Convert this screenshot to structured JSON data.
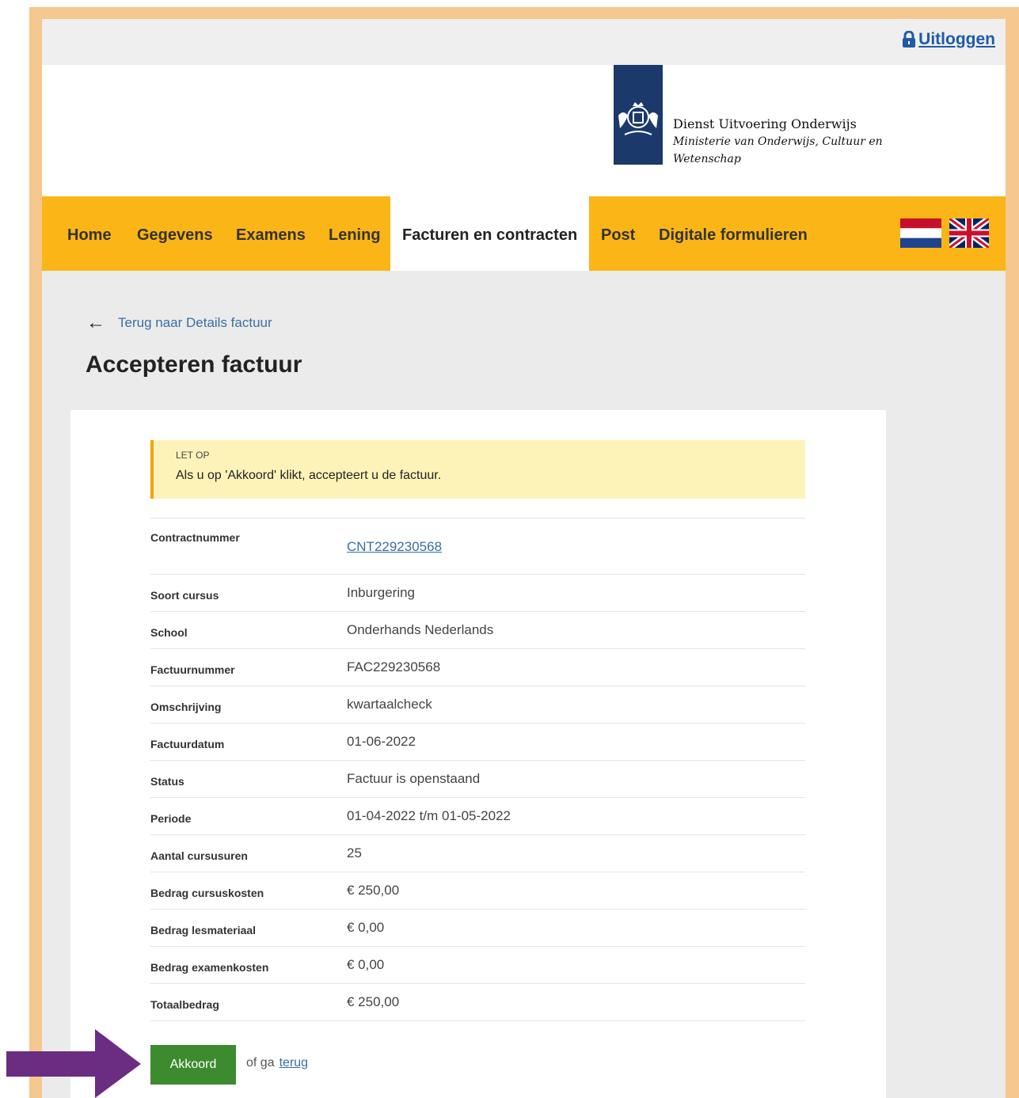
{
  "topbar": {
    "logout_label": "Uitloggen"
  },
  "header": {
    "org_name": "Dienst Uitvoering Onderwijs",
    "ministry_line1": "Ministerie van Onderwijs, Cultuur en",
    "ministry_line2": "Wetenschap"
  },
  "nav": {
    "items": [
      {
        "label": "Home"
      },
      {
        "label": "Gegevens"
      },
      {
        "label": "Examens"
      },
      {
        "label": "Lening"
      },
      {
        "label": "Facturen en contracten"
      },
      {
        "label": "Post"
      },
      {
        "label": "Digitale formulieren"
      }
    ],
    "active": "Facturen en contracten"
  },
  "back_link": "Terug naar Details factuur",
  "page_title": "Accepteren factuur",
  "notice": {
    "label": "LET OP",
    "text": "Als u op 'Akkoord' klikt, accepteert u de factuur."
  },
  "details": [
    {
      "label": "Contractnummer",
      "value": "CNT229230568"
    },
    {
      "label": "Soort cursus",
      "value": "Inburgering"
    },
    {
      "label": "School",
      "value": "Onderhands Nederlands"
    },
    {
      "label": "Factuurnummer",
      "value": "FAC229230568"
    },
    {
      "label": "Omschrijving",
      "value": "kwartaalcheck"
    },
    {
      "label": "Factuurdatum",
      "value": "01-06-2022"
    },
    {
      "label": "Status",
      "value": "Factuur is openstaand"
    },
    {
      "label": "Periode",
      "value": "01-04-2022 t/m 01-05-2022"
    },
    {
      "label": "Aantal cursusuren",
      "value": "25"
    },
    {
      "label": "Bedrag cursuskosten",
      "value": "€ 250,00"
    },
    {
      "label": "Bedrag lesmateriaal",
      "value": "€ 0,00"
    },
    {
      "label": "Bedrag examenkosten",
      "value": "€ 0,00"
    },
    {
      "label": "Totaalbedrag",
      "value": "€ 250,00"
    }
  ],
  "actions": {
    "accept_label": "Akkoord",
    "or_text": "of ga",
    "back_label": "terug"
  },
  "colors": {
    "nav_bg": "#fbb516",
    "accept_button": "#3d8b2f",
    "link": "#3a6ea5",
    "logo_blue": "#1b3a6b",
    "annotation_arrow": "#6a2d82"
  }
}
